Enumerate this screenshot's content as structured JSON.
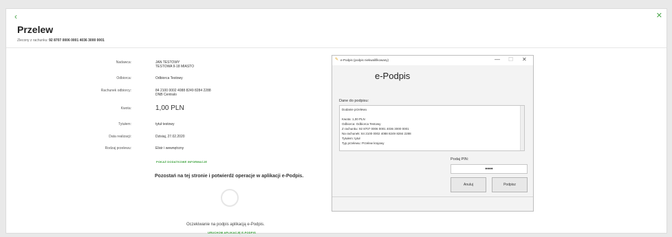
{
  "page": {
    "title": "Przelew",
    "subtitle_prefix": "Zlecony z rachunku:",
    "subtitle_account": "92 8707 0006 0001 4036 3000 0001"
  },
  "details": {
    "rows": [
      {
        "label": "Nadawca:",
        "value": "JAN TESTOWY",
        "value2": "TESTOWA 9-18 MIASTO"
      },
      {
        "label": "Odbiorca:",
        "value": "Odbiorca Testowy"
      },
      {
        "label": "Rachunek odbiorcy:",
        "value": "84 2100 0002 4088 8249 8284 2288",
        "value2": "DNB Centralo"
      },
      {
        "label": "Kwota:",
        "value": "1,00 PLN"
      },
      {
        "label": "Tytułem:",
        "value": "tytuł testowy"
      },
      {
        "label": "Data realizacji:",
        "value": "Dzisiaj, 27.02.2020"
      },
      {
        "label": "Rodzaj przelewu:",
        "value": "Elixir i wewnętrzny"
      }
    ],
    "more_info_link": "POKAŻ DODATKOWE INFORMACJE",
    "confirm_text": "Pozostań na tej stronie i potwierdź operacje w aplikacji e-Podpis.",
    "waiting_text": "Oczekiwanie na podpis aplikacją e-Podpis.",
    "launch_link": "URUCHOM APLIKACJĘ E-PODPIS"
  },
  "dialog": {
    "window_title": "e-Podpis (podpis niekwalifikowany)",
    "heading": "e-Podpis",
    "data_label": "Dane do podpisu:",
    "sign_lines": [
      "Dodanie przelewu",
      "",
      "Kwota: 1,00 PLN",
      "Odbiorca: Odbiorca Testowy",
      "Z rachunku: 92 8707 0006 0001 4036 3000 0001",
      "Na rachunek: 84 2100 0002 4088 8249 8284 2288",
      "Tytułem: tytuł",
      "Typ przelewu: Przelew krajowy"
    ],
    "pin_label": "Podaj PIN:",
    "pin_value": "••••",
    "cancel_label": "Anuluj",
    "sign_label": "Podpisz"
  },
  "icons": {
    "back": "chevron-left-icon",
    "close": "close-icon",
    "pen": "pen-icon"
  },
  "colors": {
    "accent": "#2e9b2e"
  }
}
